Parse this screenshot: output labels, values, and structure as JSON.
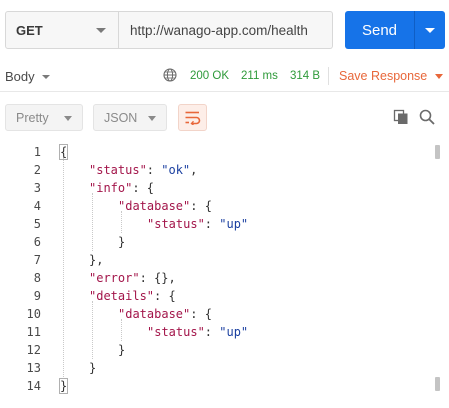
{
  "request": {
    "method": "GET",
    "url": "http://wanago-app.com/health",
    "send_label": "Send"
  },
  "response": {
    "view_tab": "Body",
    "status": "200 OK",
    "time": "211 ms",
    "size": "314 B",
    "save_label": "Save Response"
  },
  "toolbar": {
    "format": "Pretty",
    "language": "JSON"
  },
  "colors": {
    "accent": "#1673e8",
    "status_ok": "#2e9a3a",
    "save": "#e8673a",
    "json_key": "#a3154a",
    "json_string": "#1a3fa0"
  },
  "icons": [
    "globe-icon",
    "wrap-lines-icon",
    "copy-icon",
    "search-icon"
  ],
  "code_lines": [
    {
      "n": "1",
      "indent": 0,
      "parts": [
        [
          "p",
          "{"
        ]
      ]
    },
    {
      "n": "2",
      "indent": 1,
      "parts": [
        [
          "k",
          "\"status\""
        ],
        [
          "p",
          ": "
        ],
        [
          "s",
          "\"ok\""
        ],
        [
          "p",
          ","
        ]
      ]
    },
    {
      "n": "3",
      "indent": 1,
      "parts": [
        [
          "k",
          "\"info\""
        ],
        [
          "p",
          ": {"
        ]
      ]
    },
    {
      "n": "4",
      "indent": 2,
      "parts": [
        [
          "k",
          "\"database\""
        ],
        [
          "p",
          ": {"
        ]
      ]
    },
    {
      "n": "5",
      "indent": 3,
      "parts": [
        [
          "k",
          "\"status\""
        ],
        [
          "p",
          ": "
        ],
        [
          "s",
          "\"up\""
        ]
      ]
    },
    {
      "n": "6",
      "indent": 2,
      "parts": [
        [
          "p",
          "}"
        ]
      ]
    },
    {
      "n": "7",
      "indent": 1,
      "parts": [
        [
          "p",
          "},"
        ]
      ]
    },
    {
      "n": "8",
      "indent": 1,
      "parts": [
        [
          "k",
          "\"error\""
        ],
        [
          "p",
          ": {},"
        ]
      ]
    },
    {
      "n": "9",
      "indent": 1,
      "parts": [
        [
          "k",
          "\"details\""
        ],
        [
          "p",
          ": {"
        ]
      ]
    },
    {
      "n": "10",
      "indent": 2,
      "parts": [
        [
          "k",
          "\"database\""
        ],
        [
          "p",
          ": {"
        ]
      ]
    },
    {
      "n": "11",
      "indent": 3,
      "parts": [
        [
          "k",
          "\"status\""
        ],
        [
          "p",
          ": "
        ],
        [
          "s",
          "\"up\""
        ]
      ]
    },
    {
      "n": "12",
      "indent": 2,
      "parts": [
        [
          "p",
          "}"
        ]
      ]
    },
    {
      "n": "13",
      "indent": 1,
      "parts": [
        [
          "p",
          "}"
        ]
      ]
    },
    {
      "n": "14",
      "indent": 0,
      "parts": [
        [
          "p",
          "}"
        ]
      ]
    }
  ]
}
